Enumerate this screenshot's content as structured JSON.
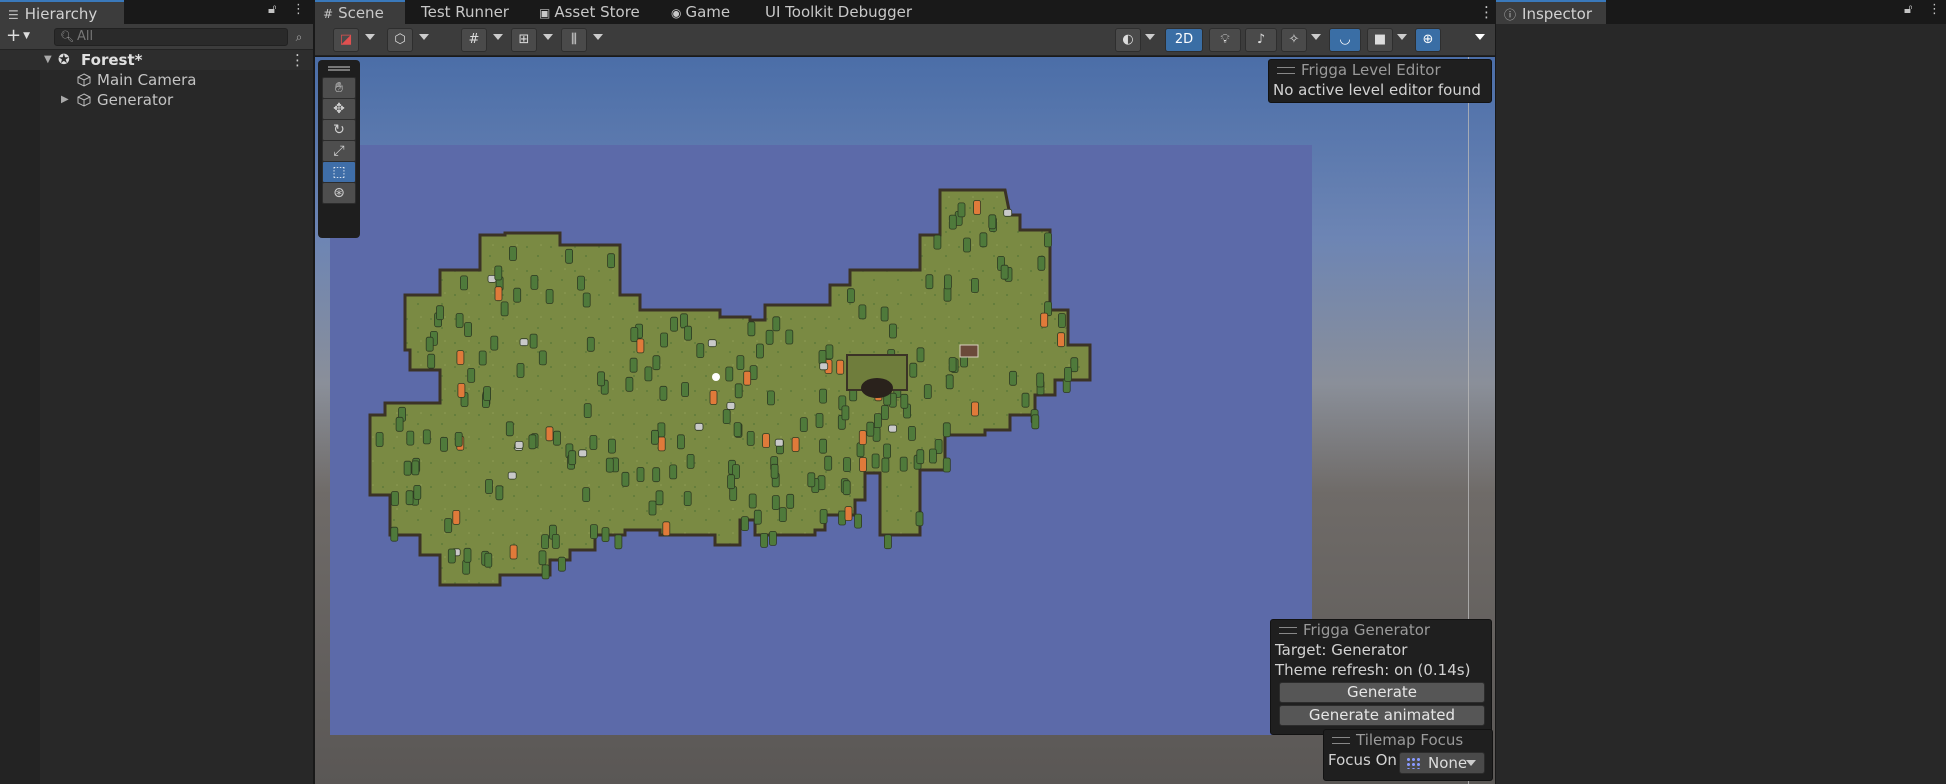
{
  "hierarchy": {
    "tab_label": "Hierarchy",
    "tab_icon": "list-icon",
    "search_placeholder": "All",
    "scene_name": "Forest*",
    "items": [
      {
        "label": "Main Camera",
        "icon": "gameobject-cube-icon",
        "expandable": false
      },
      {
        "label": "Generator",
        "icon": "gameobject-cube-icon",
        "expandable": true
      }
    ]
  },
  "scene_tabs": [
    {
      "label": "Scene",
      "icon": "grid-icon",
      "active": true
    },
    {
      "label": "Test Runner",
      "icon": "",
      "active": false
    },
    {
      "label": "Asset Store",
      "icon": "bag-icon",
      "active": false
    },
    {
      "label": "Game",
      "icon": "gamepad-icon",
      "active": false
    },
    {
      "label": "UI Toolkit Debugger",
      "icon": "",
      "active": false
    }
  ],
  "scene_toolbar": {
    "mode_2d_label": "2D"
  },
  "frigga_level_editor": {
    "title": "Frigga Level Editor",
    "message": "No active level editor found"
  },
  "frigga_generator": {
    "title": "Frigga Generator",
    "target": "Target: Generator",
    "theme_refresh": "Theme refresh: on (0.14s)",
    "generate_label": "Generate",
    "generate_animated_label": "Generate animated"
  },
  "tilemap_focus": {
    "title": "Tilemap Focus",
    "focus_label": "Focus On",
    "focus_value": "None"
  },
  "inspector": {
    "tab_label": "Inspector",
    "tab_icon": "info-icon"
  },
  "colors": {
    "accent": "#3a79bb",
    "grass": "#7a8a43",
    "water": "#5c6aa9",
    "panel": "#282828"
  }
}
